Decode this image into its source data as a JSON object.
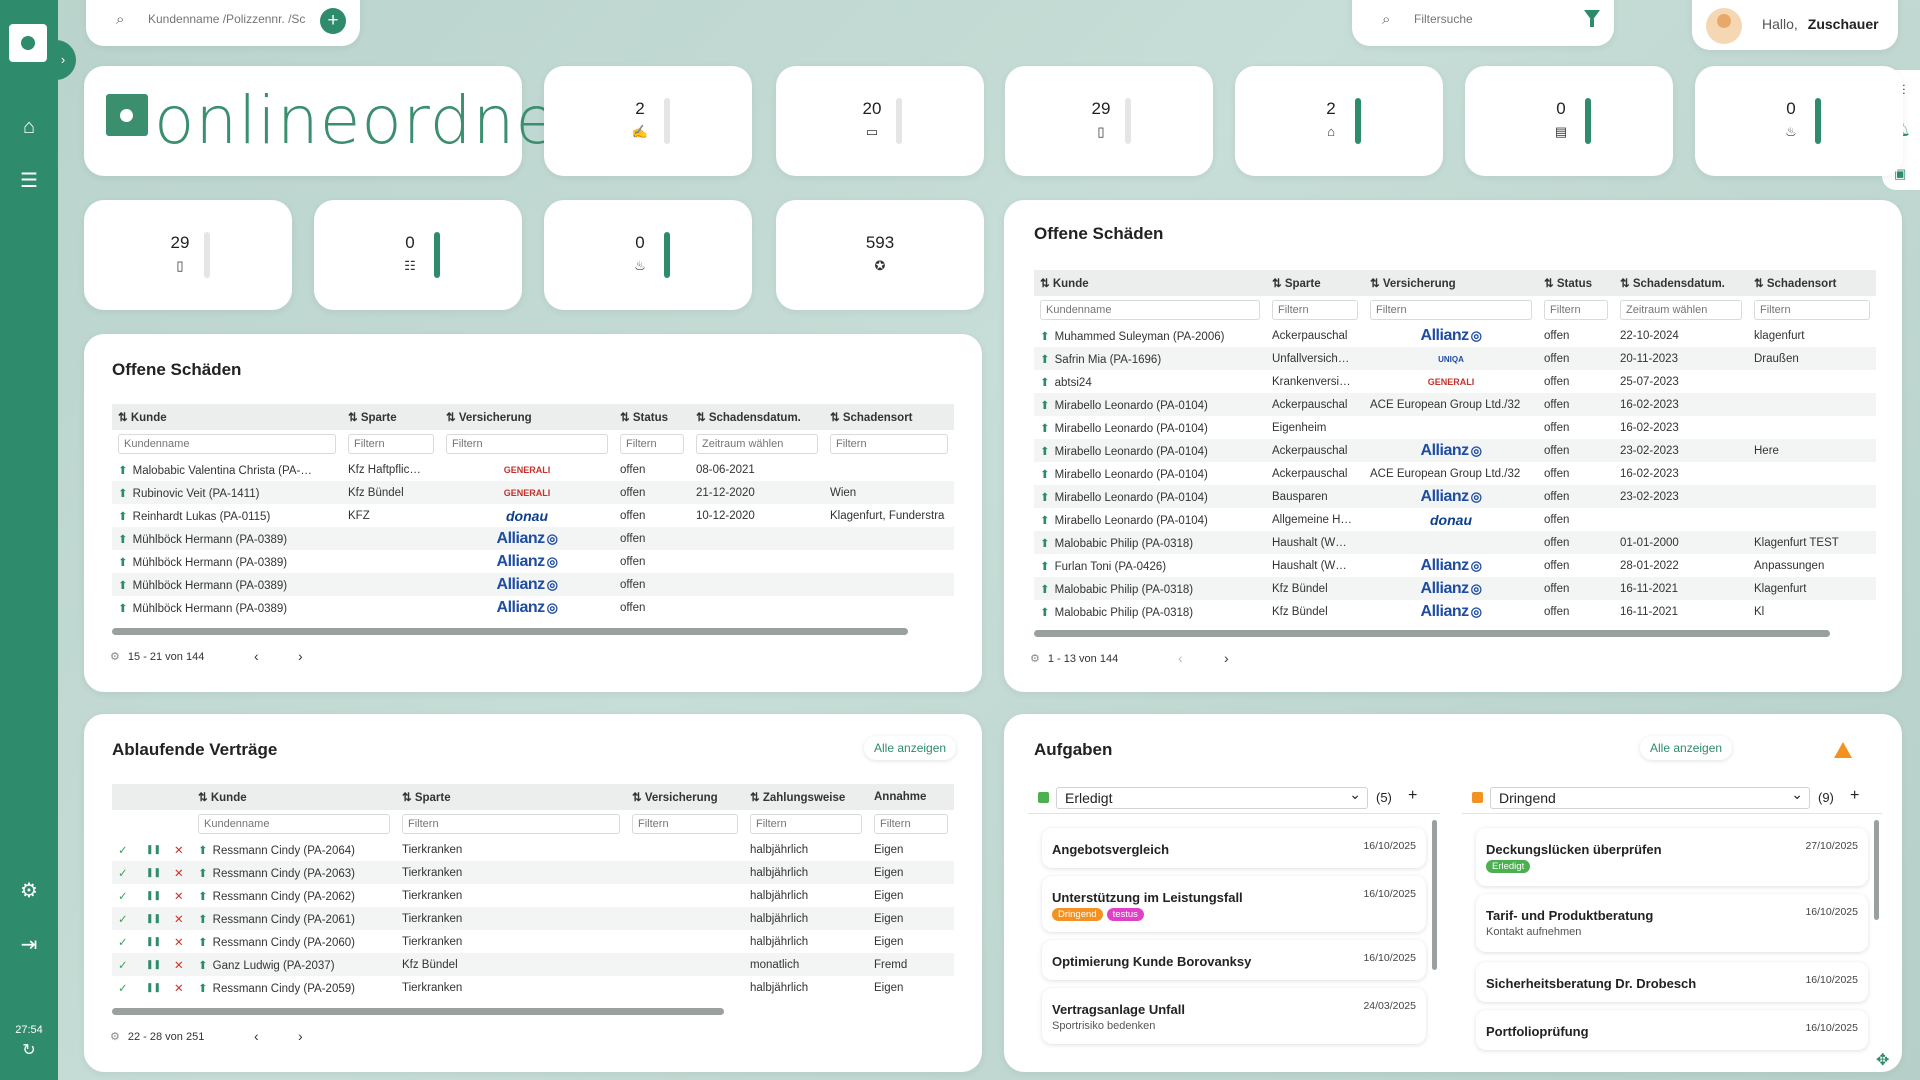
{
  "topbar": {
    "search_placeholder": "Kundenname /Polizzennr. /Sc",
    "filter_placeholder": "Filtersuche",
    "greeting": "Hallo,",
    "username": "Zuschauer"
  },
  "sidebar": {
    "time": "27:54"
  },
  "logo_text": "onlineordner",
  "stats": [
    {
      "value": "2",
      "icon": "sign-icon",
      "fill": 0
    },
    {
      "value": "20",
      "icon": "devices-icon",
      "fill": 0
    },
    {
      "value": "29",
      "icon": "phone-icon",
      "fill": 0.05
    },
    {
      "value": "2",
      "icon": "inbox-icon",
      "fill": 1
    },
    {
      "value": "0",
      "icon": "document-icon",
      "fill": 1
    },
    {
      "value": "0",
      "icon": "fire-icon",
      "fill": 1
    },
    {
      "value": "29",
      "icon": "phone-icon",
      "fill": 0.05
    },
    {
      "value": "0",
      "icon": "checklist-icon",
      "fill": 1
    },
    {
      "value": "0",
      "icon": "fire-icon",
      "fill": 1
    },
    {
      "value": "593",
      "icon": "award-icon",
      "fill": 0
    }
  ],
  "claims_left": {
    "title": "Offene Schäden",
    "headers": [
      "Kunde",
      "Sparte",
      "Versicherung",
      "Status",
      "Schadensdatum.",
      "Schadensort"
    ],
    "filters": [
      "Kundenname",
      "Filtern",
      "Filtern",
      "Filtern",
      "Zeitraum wählen",
      "Filtern"
    ],
    "rows": [
      {
        "kunde": "Malobabic Valentina Christa (PA-…",
        "sparte": "Kfz Haftpflic…",
        "vers": "generali",
        "status": "offen",
        "datum": "08-06-2021",
        "ort": ""
      },
      {
        "kunde": "Rubinovic Veit (PA-1411)",
        "sparte": "Kfz Bündel",
        "vers": "generali",
        "status": "offen",
        "datum": "21-12-2020",
        "ort": "Wien"
      },
      {
        "kunde": "Reinhardt Lukas (PA-0115)",
        "sparte": "KFZ",
        "vers": "donau",
        "status": "offen",
        "datum": "10-12-2020",
        "ort": "Klagenfurt, Funderstra"
      },
      {
        "kunde": "Mühlböck Hermann (PA-0389)",
        "sparte": "",
        "vers": "allianz",
        "status": "offen",
        "datum": "",
        "ort": ""
      },
      {
        "kunde": "Mühlböck Hermann (PA-0389)",
        "sparte": "",
        "vers": "allianz",
        "status": "offen",
        "datum": "",
        "ort": ""
      },
      {
        "kunde": "Mühlböck Hermann (PA-0389)",
        "sparte": "",
        "vers": "allianz",
        "status": "offen",
        "datum": "",
        "ort": ""
      },
      {
        "kunde": "Mühlböck Hermann (PA-0389)",
        "sparte": "",
        "vers": "allianz",
        "status": "offen",
        "datum": "",
        "ort": ""
      }
    ],
    "pager": "15 - 21 von 144"
  },
  "claims_right": {
    "title": "Offene Schäden",
    "headers": [
      "Kunde",
      "Sparte",
      "Versicherung",
      "Status",
      "Schadensdatum.",
      "Schadensort"
    ],
    "filters": [
      "Kundenname",
      "Filtern",
      "Filtern",
      "Filtern",
      "Zeitraum wählen",
      "Filtern"
    ],
    "rows": [
      {
        "kunde": "Muhammed Suleyman (PA-2006)",
        "sparte": "Ackerpauschal",
        "vers": "allianz",
        "status": "offen",
        "datum": "22-10-2024",
        "ort": "klagenfurt"
      },
      {
        "kunde": "Safrin Mia (PA-1696)",
        "sparte": "Unfallversich…",
        "vers": "uniqa",
        "status": "offen",
        "datum": "20-11-2023",
        "ort": "Draußen"
      },
      {
        "kunde": "abtsi24",
        "sparte": "Krankenversi…",
        "vers": "generali",
        "status": "offen",
        "datum": "25-07-2023",
        "ort": ""
      },
      {
        "kunde": "Mirabello Leonardo (PA-0104)",
        "sparte": "Ackerpauschal",
        "vers": "ACE European Group Ltd./32",
        "status": "offen",
        "datum": "16-02-2023",
        "ort": ""
      },
      {
        "kunde": "Mirabello Leonardo (PA-0104)",
        "sparte": "Eigenheim",
        "vers": "",
        "status": "offen",
        "datum": "16-02-2023",
        "ort": ""
      },
      {
        "kunde": "Mirabello Leonardo (PA-0104)",
        "sparte": "Ackerpauschal",
        "vers": "allianz",
        "status": "offen",
        "datum": "23-02-2023",
        "ort": "Here"
      },
      {
        "kunde": "Mirabello Leonardo (PA-0104)",
        "sparte": "Ackerpauschal",
        "vers": "ACE European Group Ltd./32",
        "status": "offen",
        "datum": "16-02-2023",
        "ort": ""
      },
      {
        "kunde": "Mirabello Leonardo (PA-0104)",
        "sparte": "Bausparen",
        "vers": "allianz",
        "status": "offen",
        "datum": "23-02-2023",
        "ort": ""
      },
      {
        "kunde": "Mirabello Leonardo (PA-0104)",
        "sparte": "Allgemeine H…",
        "vers": "donau",
        "status": "offen",
        "datum": "",
        "ort": ""
      },
      {
        "kunde": "Malobabic Philip (PA-0318)",
        "sparte": "Haushalt (W…",
        "vers": "",
        "status": "offen",
        "datum": "01-01-2000",
        "ort": "Klagenfurt TEST"
      },
      {
        "kunde": "Furlan Toni (PA-0426)",
        "sparte": "Haushalt (W…",
        "vers": "allianz",
        "status": "offen",
        "datum": "28-01-2022",
        "ort": "Anpassungen"
      },
      {
        "kunde": "Malobabic Philip (PA-0318)",
        "sparte": "Kfz Bündel",
        "vers": "allianz",
        "status": "offen",
        "datum": "16-11-2021",
        "ort": "Klagenfurt"
      },
      {
        "kunde": "Malobabic Philip (PA-0318)",
        "sparte": "Kfz Bündel",
        "vers": "allianz",
        "status": "offen",
        "datum": "16-11-2021",
        "ort": "Kl"
      }
    ],
    "pager": "1 - 13 von 144"
  },
  "contracts": {
    "title": "Ablaufende Verträge",
    "show_all": "Alle anzeigen",
    "headers": [
      "Kunde",
      "Sparte",
      "Versicherung",
      "Zahlungsweise",
      "Annahme"
    ],
    "filters": [
      "Kundenname",
      "Filtern",
      "Filtern",
      "Filtern",
      "Filtern"
    ],
    "rows": [
      {
        "kunde": "Ressmann Cindy (PA-2064)",
        "sparte": "Tierkranken",
        "vers": "",
        "zahl": "halbjährlich",
        "ann": "Eigen"
      },
      {
        "kunde": "Ressmann Cindy (PA-2063)",
        "sparte": "Tierkranken",
        "vers": "",
        "zahl": "halbjährlich",
        "ann": "Eigen"
      },
      {
        "kunde": "Ressmann Cindy (PA-2062)",
        "sparte": "Tierkranken",
        "vers": "",
        "zahl": "halbjährlich",
        "ann": "Eigen"
      },
      {
        "kunde": "Ressmann Cindy (PA-2061)",
        "sparte": "Tierkranken",
        "vers": "",
        "zahl": "halbjährlich",
        "ann": "Eigen"
      },
      {
        "kunde": "Ressmann Cindy (PA-2060)",
        "sparte": "Tierkranken",
        "vers": "",
        "zahl": "halbjährlich",
        "ann": "Eigen"
      },
      {
        "kunde": "Ganz Ludwig (PA-2037)",
        "sparte": "Kfz Bündel",
        "vers": "",
        "zahl": "monatlich",
        "ann": "Fremd"
      },
      {
        "kunde": "Ressmann Cindy (PA-2059)",
        "sparte": "Tierkranken",
        "vers": "",
        "zahl": "halbjährlich",
        "ann": "Eigen"
      }
    ],
    "pager": "22 - 28 von 251"
  },
  "tasks": {
    "title": "Aufgaben",
    "show_all": "Alle anzeigen",
    "left": {
      "status": "Erledigt",
      "count": "(5)",
      "color": "#4caf50",
      "items": [
        {
          "title": "Angebotsvergleich",
          "date": "16/10/2025",
          "sub": ""
        },
        {
          "title": "Unterstützung im Leistungsfall",
          "date": "16/10/2025",
          "sub": ""
        },
        {
          "title": "Optimierung Kunde Borovanksy",
          "date": "16/10/2025",
          "sub": ""
        },
        {
          "title": "Vertragsanlage Unfall",
          "date": "24/03/2025",
          "sub": "Sportrisiko bedenken"
        }
      ],
      "tags": [
        "Dringend",
        "testus"
      ]
    },
    "right": {
      "status": "Dringend",
      "count": "(9)",
      "color": "#f39220",
      "items": [
        {
          "title": "Deckungslücken überprüfen",
          "date": "27/10/2025",
          "sub": ""
        },
        {
          "title": "Tarif- und Produktberatung",
          "date": "16/10/2025",
          "sub": "Kontakt aufnehmen"
        },
        {
          "title": "Sicherheitsberatung Dr. Drobesch",
          "date": "16/10/2025",
          "sub": ""
        },
        {
          "title": "Portfolioprüfung",
          "date": "16/10/2025",
          "sub": ""
        }
      ],
      "tags": [
        "Erledigt"
      ]
    }
  },
  "colors": {
    "accent": "#2e8b6c",
    "tag_orange": "#f39220",
    "tag_pink": "#e040c8",
    "tag_green": "#4caf50"
  }
}
